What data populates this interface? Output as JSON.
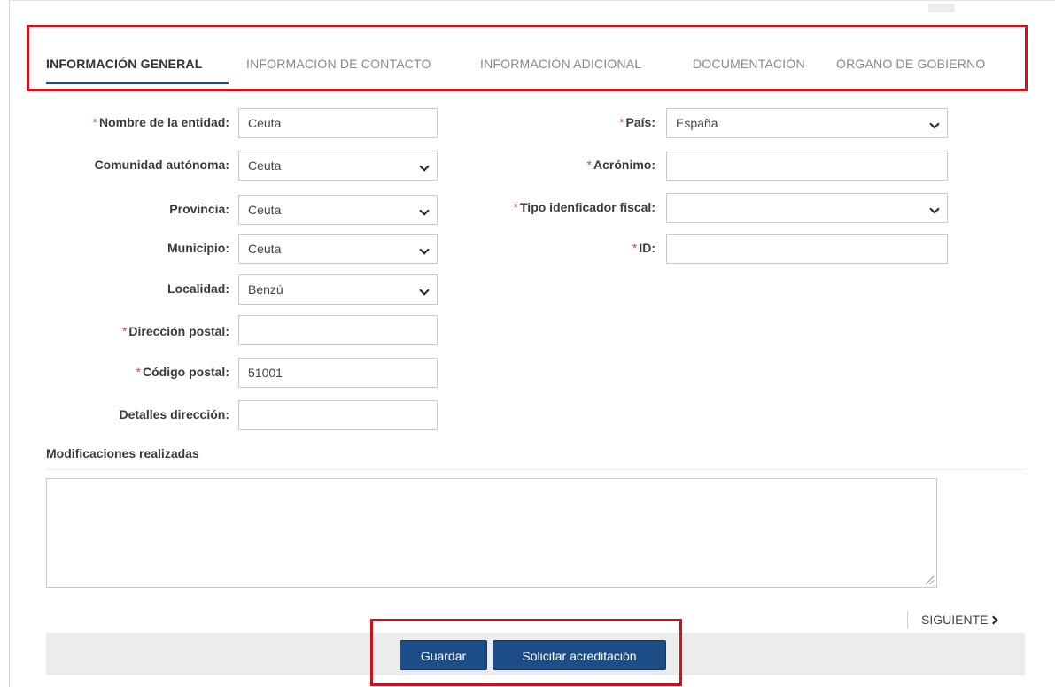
{
  "tabs": [
    {
      "label": "INFORMACIÓN GENERAL",
      "active": true
    },
    {
      "label": "INFORMACIÓN DE CONTACTO",
      "active": false
    },
    {
      "label": "INFORMACIÓN ADICIONAL",
      "active": false
    },
    {
      "label": "DOCUMENTACIÓN",
      "active": false
    },
    {
      "label": "ÓRGANO DE GOBIERNO",
      "active": false
    }
  ],
  "form": {
    "required_mark": "*",
    "left": {
      "nombre": {
        "label": "Nombre de la entidad:",
        "value": "Ceuta"
      },
      "comunidad": {
        "label": "Comunidad autónoma:",
        "value": "Ceuta"
      },
      "provincia": {
        "label": "Provincia:",
        "value": "Ceuta"
      },
      "municipio": {
        "label": "Municipio:",
        "value": "Ceuta"
      },
      "localidad": {
        "label": "Localidad:",
        "value": "Benzú"
      },
      "direccion": {
        "label": "Dirección postal:",
        "value": ""
      },
      "codigo_postal": {
        "label": "Código postal:",
        "value": "51001"
      },
      "detalles": {
        "label": "Detalles dirección:",
        "value": ""
      }
    },
    "right": {
      "pais": {
        "label": "País:",
        "value": "España"
      },
      "acronimo": {
        "label": "Acrónimo:",
        "value": ""
      },
      "tipo_id": {
        "label": "Tipo idenficador fiscal:",
        "value": ""
      },
      "id": {
        "label": "ID:",
        "value": ""
      }
    }
  },
  "modificaciones": {
    "title": "Modificaciones realizadas",
    "value": ""
  },
  "nav": {
    "next_label": "SIGUIENTE"
  },
  "actions": {
    "save_label": "Guardar",
    "request_label": "Solicitar acreditación"
  },
  "colors": {
    "primary": "#1d4d86",
    "highlight": "#d0111b",
    "required": "#e0473f"
  }
}
